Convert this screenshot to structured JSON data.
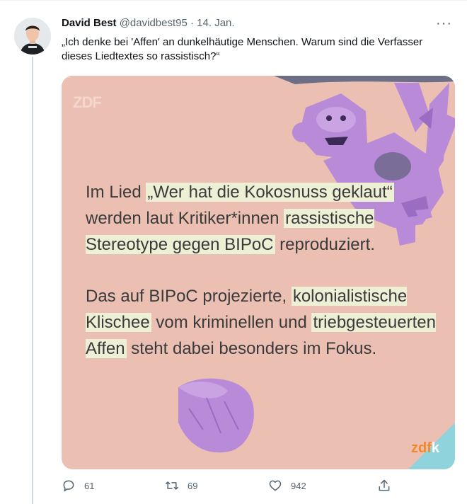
{
  "author": {
    "name": "David Best",
    "handle": "@davidbest95",
    "separator": "·",
    "date": "14. Jan."
  },
  "tweet": {
    "text": "„Ich denke bei 'Affen' an dunkelhäutige Menschen. Warum sind die Verfasser dieses Liedtextes so rassistisch?“"
  },
  "more_label": "···",
  "image": {
    "logo_top": "ZDF",
    "logo_bottom_a": "zdf",
    "logo_bottom_b": "k",
    "p1_a": "Im Lied ",
    "p1_b": "„Wer hat die Kokosnuss geklaut“",
    "p1_c": " werden laut Kritiker*innen ",
    "p1_d": "rassistische Stereotype gegen BIPoC",
    "p1_e": " reproduziert.",
    "p2_a": "Das auf BIPoC projezierte, ",
    "p2_b": "kolonialistische Klischee",
    "p2_c": " vom kriminellen und ",
    "p2_d": "triebgesteuerten Affen",
    "p2_e": " steht dabei besonders im Fokus.",
    "colors": {
      "background": "#ebc0b3",
      "monkey": "#b88ad8",
      "highlight": "#eef0d6",
      "corner": "#8fd3dc"
    }
  },
  "actions": {
    "reply_count": "61",
    "retweet_count": "69",
    "like_count": "942"
  }
}
